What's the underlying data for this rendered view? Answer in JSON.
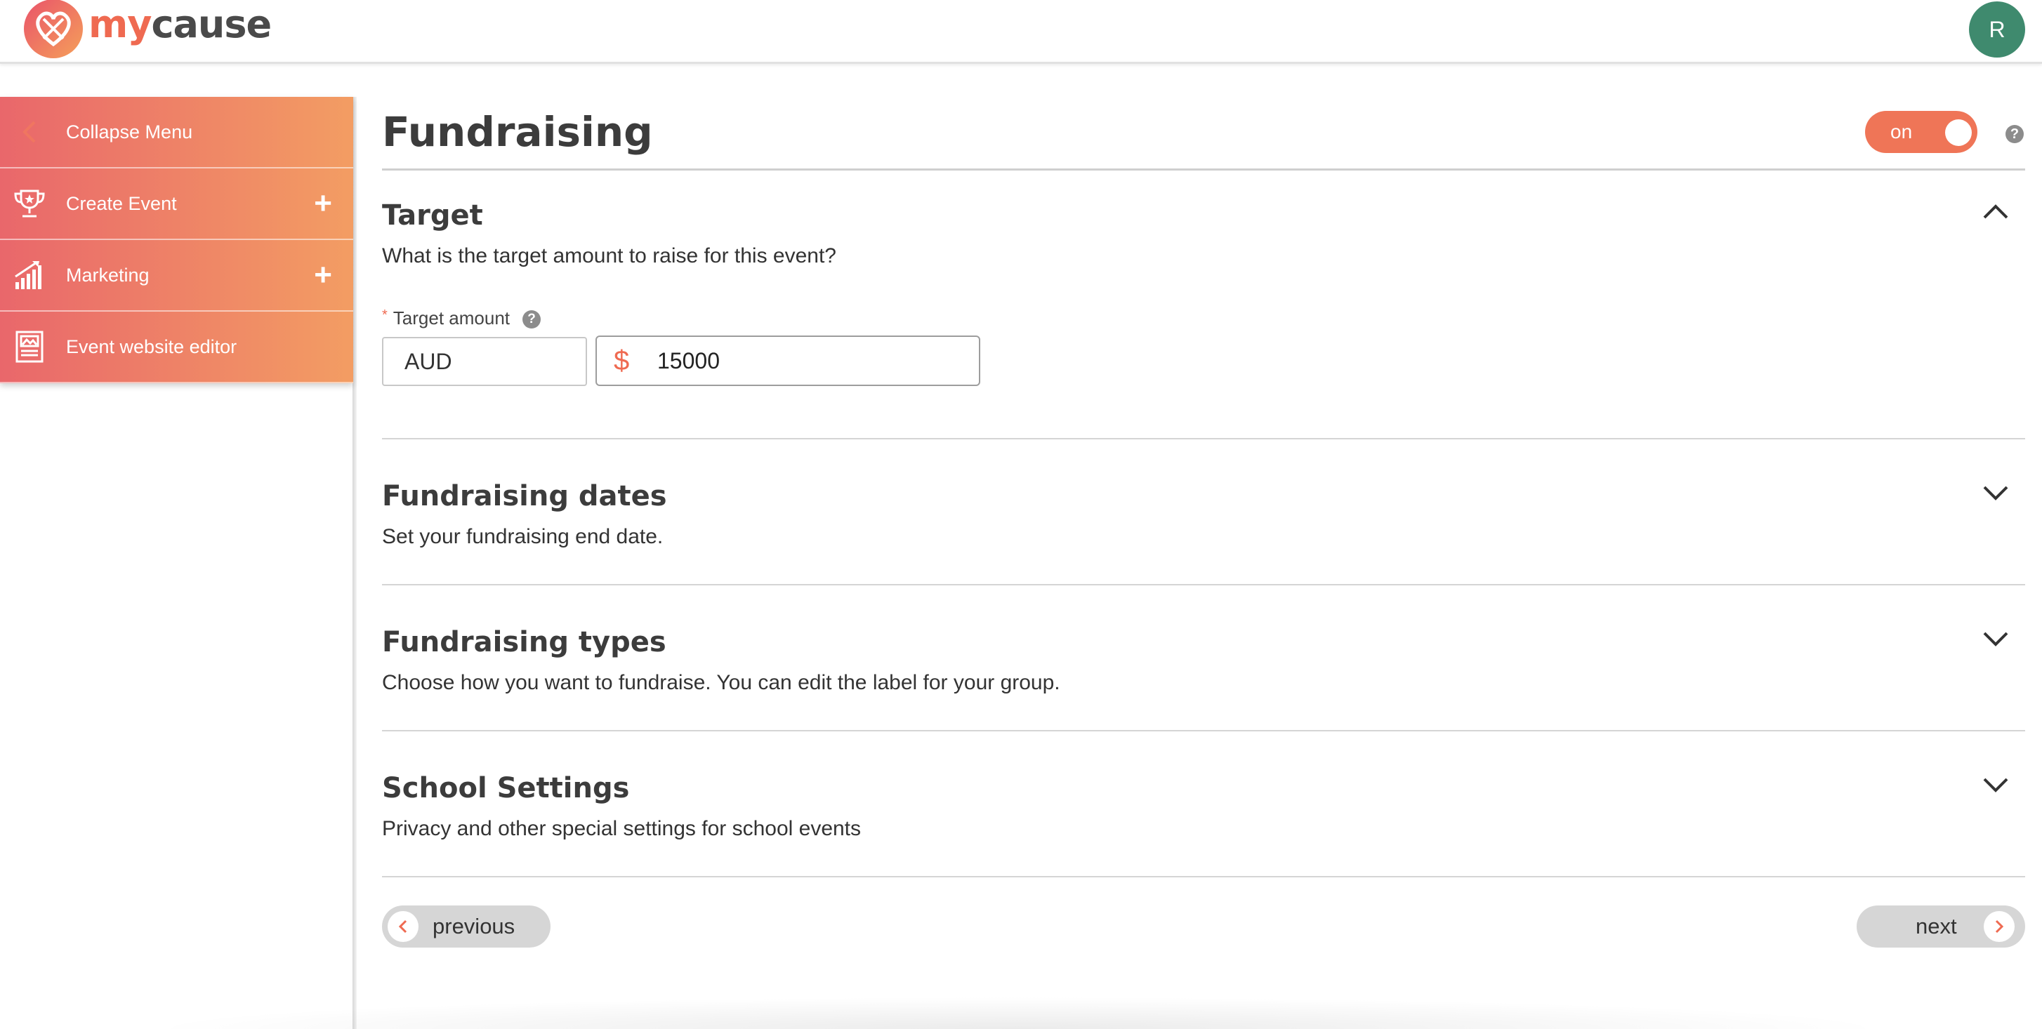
{
  "brand": {
    "logo_my": "my",
    "logo_cause": "cause",
    "accent": "#ef6a51"
  },
  "user": {
    "avatar_initial": "R"
  },
  "sidebar": {
    "items": [
      {
        "label": "Collapse Menu",
        "icon": "chevron-left-icon"
      },
      {
        "label": "Create Event",
        "icon": "trophy-icon",
        "action": "+"
      },
      {
        "label": "Marketing",
        "icon": "growth-chart-icon",
        "action": "+"
      },
      {
        "label": "Event website editor",
        "icon": "website-editor-icon"
      }
    ]
  },
  "page": {
    "title": "Fundraising",
    "toggle_label": "on",
    "help": "?"
  },
  "sections": {
    "target": {
      "title": "Target",
      "description": "What is the target amount to raise for this event?",
      "field_label": "Target amount",
      "required_mark": "*",
      "help": "?",
      "currency": "AUD",
      "currency_symbol": "$",
      "amount": "15000",
      "expanded": true
    },
    "dates": {
      "title": "Fundraising dates",
      "description": "Set your fundraising end date."
    },
    "types": {
      "title": "Fundraising types",
      "description": "Choose how you want to fundraise. You can edit the label for your group."
    },
    "school": {
      "title": "School Settings",
      "description": "Privacy and other special settings for school events"
    }
  },
  "nav": {
    "previous_label": "previous",
    "next_label": "next"
  }
}
